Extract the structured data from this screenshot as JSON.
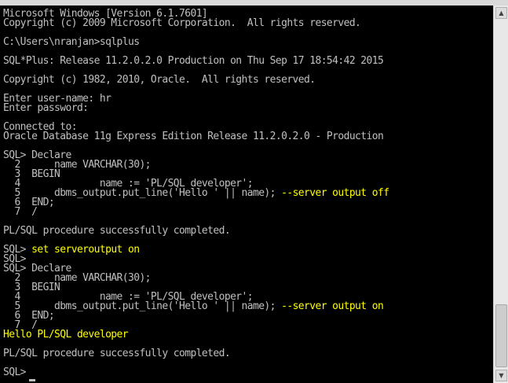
{
  "console": {
    "colors": {
      "background": "#000000",
      "text": "#c0c0c0",
      "highlight": "#ffff00"
    },
    "lines": [
      {
        "text": "Microsoft Windows [Version 6.1.7601]"
      },
      {
        "text": "Copyright (c) 2009 Microsoft Corporation.  All rights reserved."
      },
      {
        "text": ""
      },
      {
        "text": "C:\\Users\\nranjan>sqlplus"
      },
      {
        "text": ""
      },
      {
        "text": "SQL*Plus: Release 11.2.0.2.0 Production on Thu Sep 17 18:54:42 2015"
      },
      {
        "text": ""
      },
      {
        "text": "Copyright (c) 1982, 2010, Oracle.  All rights reserved."
      },
      {
        "text": ""
      },
      {
        "text": "Enter user-name: hr"
      },
      {
        "text": "Enter password:"
      },
      {
        "text": ""
      },
      {
        "text": "Connected to:"
      },
      {
        "text": "Oracle Database 11g Express Edition Release 11.2.0.2.0 - Production"
      },
      {
        "text": ""
      },
      {
        "text": "SQL> Declare"
      },
      {
        "text": "  2      name VARCHAR(30);"
      },
      {
        "text": "  3  BEGIN"
      },
      {
        "text": "  4              name := 'PL/SQL developer';"
      },
      {
        "text": "  5      dbms_output.put_line('Hello ' || name); ",
        "highlight": "--server output off"
      },
      {
        "text": "  6  END;"
      },
      {
        "text": "  7  /"
      },
      {
        "text": ""
      },
      {
        "text": "PL/SQL procedure successfully completed."
      },
      {
        "text": ""
      },
      {
        "text": "SQL> ",
        "highlight": "set serveroutput on"
      },
      {
        "text": "SQL>"
      },
      {
        "text": "SQL> Declare"
      },
      {
        "text": "  2      name VARCHAR(30);"
      },
      {
        "text": "  3  BEGIN"
      },
      {
        "text": "  4              name := 'PL/SQL developer';"
      },
      {
        "text": "  5      dbms_output.put_line('Hello ' || name); ",
        "highlight": "--server output on"
      },
      {
        "text": "  6  END;"
      },
      {
        "text": "  7  /"
      },
      {
        "text": "",
        "highlight": "Hello PL/SQL developer"
      },
      {
        "text": ""
      },
      {
        "text": "PL/SQL procedure successfully completed."
      },
      {
        "text": ""
      },
      {
        "text": "SQL>"
      }
    ]
  },
  "scrollbar": {
    "up_icon": "▲",
    "down_icon": "▼"
  }
}
